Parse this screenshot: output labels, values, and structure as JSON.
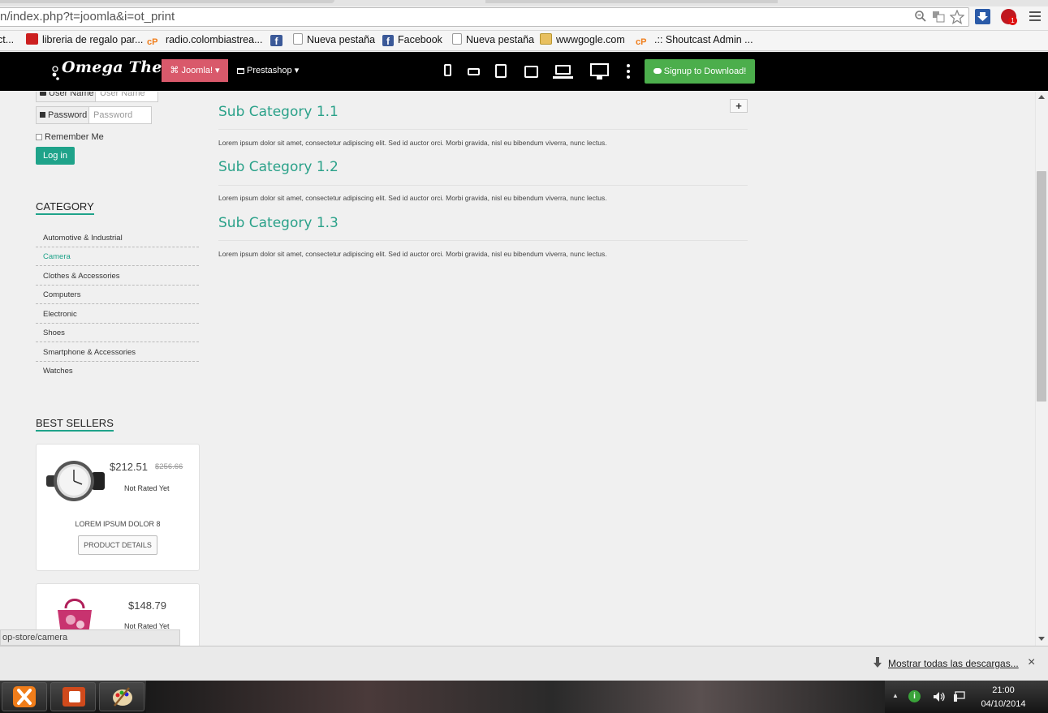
{
  "browser": {
    "url": "n/index.php?t=joomla&i=ot_print",
    "bookmarks": [
      {
        "label": "ct...",
        "icon": "page-icon"
      },
      {
        "label": "libreria de regalo par...",
        "icon": "youtube-icon",
        "color": "#cc1f1f"
      },
      {
        "label": "radio.colombiastrea...",
        "icon": "cpanel-icon",
        "color": "#f07d1a"
      },
      {
        "label": "Nueva pestaña",
        "icon": "page-icon"
      },
      {
        "label": "Facebook",
        "icon": "facebook-icon",
        "color": "#3b5998"
      },
      {
        "label": "Nueva pestaña",
        "icon": "page-icon"
      },
      {
        "label": "wwwgogle.com",
        "icon": "folder-icon",
        "color": "#e8c060"
      },
      {
        "label": ".:: Shoutcast Admin ...",
        "icon": "cpanel-icon",
        "color": "#f07d1a"
      }
    ],
    "fb_glyph": "f",
    "cp_glyph": "cP",
    "status_text": "op-store/camera",
    "download_text": "Mostrar todas las descargas...",
    "close_glyph": "×",
    "ext_badge": "1"
  },
  "site": {
    "logo": "Omega Theme",
    "nav": {
      "joomla": "⌘ Joomla! ▾",
      "prestashop": "Prestashop ▾",
      "signup": "Signup to Download!"
    },
    "login": {
      "username_label": "User Name",
      "username_placeholder": "User Name",
      "password_label": "Password",
      "password_placeholder": "Password",
      "remember": "Remember Me",
      "button": "Log in"
    },
    "category_heading": "CATEGORY",
    "categories": [
      "Automotive & Industrial",
      "Camera",
      "Clothes & Accessories",
      "Computers",
      "Electronic",
      "Shoes",
      "Smartphone & Accessories",
      "Watches"
    ],
    "active_category": "Camera",
    "accent_color": "#1fa38a",
    "best_sellers_heading": "BEST SELLERS",
    "products": [
      {
        "price": "$212.51",
        "old_price": "$256.66",
        "rating": "Not Rated Yet",
        "name": "LOREM IPSUM DOLOR 8",
        "details_button": "PRODUCT DETAILS"
      },
      {
        "price": "$148.79",
        "rating": "Not Rated Yet"
      }
    ],
    "subcategories": [
      {
        "title": "Sub Category 1.1",
        "text": "Lorem ipsum dolor sit amet, consectetur adipiscing elit. Sed id auctor orci. Morbi gravida, nisl eu bibendum viverra, nunc lectus."
      },
      {
        "title": "Sub Category 1.2",
        "text": "Lorem ipsum dolor sit amet, consectetur adipiscing elit. Sed id auctor orci. Morbi gravida, nisl eu bibendum viverra, nunc lectus."
      },
      {
        "title": "Sub Category 1.3",
        "text": "Lorem ipsum dolor sit amet, consectetur adipiscing elit. Sed id auctor orci. Morbi gravida, nisl eu bibendum viverra, nunc lectus."
      }
    ],
    "plus_glyph": "+"
  },
  "taskbar": {
    "time": "21:00",
    "date": "04/10/2014",
    "up_arrow": "▲"
  }
}
